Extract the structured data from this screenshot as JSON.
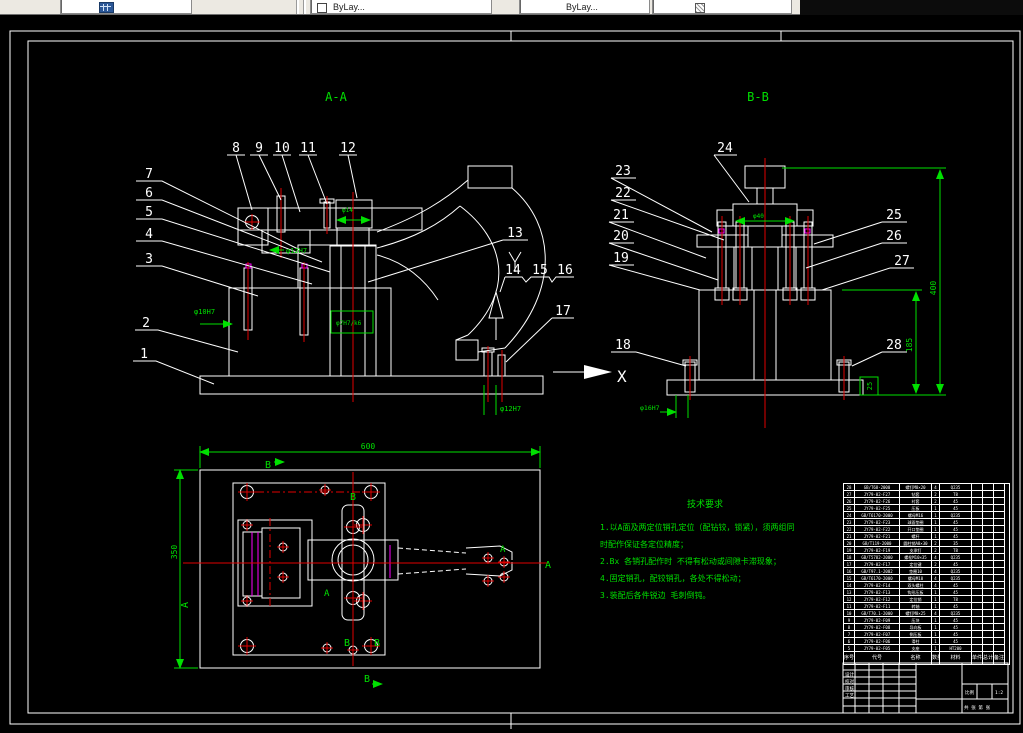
{
  "toolbar": {
    "color_combo": "ByLay...",
    "linetype_combo": "ByLay...",
    "lineweight_combo": ""
  },
  "sheet": {
    "section_a_title": "A-A",
    "section_b_title": "B-B"
  },
  "callouts": {
    "aa_left": [
      "7",
      "6",
      "5",
      "4",
      "3"
    ],
    "aa_lower_left": [
      "2",
      "1"
    ],
    "aa_top": [
      "8",
      "9",
      "10",
      "11",
      "12"
    ],
    "aa_right": [
      "13",
      "14",
      "15",
      "16",
      "17"
    ],
    "bb_top": [
      "24"
    ],
    "bb_left": [
      "23",
      "22",
      "21",
      "20",
      "19"
    ],
    "bb_right": [
      "25",
      "26",
      "27"
    ],
    "bb_bottom_left": [
      "18"
    ],
    "bb_bottom_right": [
      "28"
    ],
    "x_mark": "X"
  },
  "dims": {
    "plan_w": "600",
    "plan_h": "350",
    "total_h": "400",
    "base_h": "185",
    "plate_t": "25",
    "bore_center": "φ7H7/k6",
    "pin_left": "φ10H7",
    "pin_mid": "φ12H7",
    "pin_bottom_a": "φ12H7",
    "pin_bottom_b": "φ16H7",
    "nut_dia": "φ40",
    "arm_dia": "φ14"
  },
  "plan_marks": {
    "b_top": "B",
    "b_in_top": "B",
    "b_in_bot": "B",
    "b_out_bot": "B",
    "bl": "B",
    "a_left": "A",
    "a_right": "A",
    "a_mid": "A",
    "a_in": "A"
  },
  "tech_notes": {
    "title": "技术要求",
    "lines": [
      "1.以A面及两定位销孔定位（配钻铰，锁紧），须两组同",
      "时配作保证各定位精度；",
      "2.Bx 各销孔配作时 不得有松动或间隙卡滞现象；",
      "4.固定销孔，配铰销孔，各处不得松动；",
      "3.装配后各件锐边 毛刺倒钝。"
    ]
  },
  "bom": {
    "headers": [
      "序号",
      "代号",
      "名称",
      "数量",
      "材料",
      "单件",
      "总计",
      "备注"
    ],
    "rows": [
      [
        "28",
        "GB/T68-2000",
        "螺钉M8×20",
        "4",
        "Q235",
        "",
        "",
        ""
      ],
      [
        "27",
        "JY79-02-F27",
        "钻套",
        "2",
        "T8",
        "",
        "",
        ""
      ],
      [
        "26",
        "JY79-02-F26",
        "衬套",
        "2",
        "45",
        "",
        "",
        ""
      ],
      [
        "25",
        "JY79-02-F25",
        "压板",
        "1",
        "45",
        "",
        "",
        ""
      ],
      [
        "24",
        "GB/T6170-2000",
        "螺母M16",
        "1",
        "Q235",
        "",
        "",
        ""
      ],
      [
        "23",
        "JY79-02-F23",
        "球面垫圈",
        "1",
        "45",
        "",
        "",
        ""
      ],
      [
        "22",
        "JY79-02-F22",
        "开口垫圈",
        "1",
        "45",
        "",
        "",
        ""
      ],
      [
        "21",
        "JY79-02-F21",
        "螺杆",
        "1",
        "45",
        "",
        "",
        ""
      ],
      [
        "20",
        "GB/T119-2000",
        "圆柱销A8×30",
        "2",
        "35",
        "",
        "",
        ""
      ],
      [
        "19",
        "JY79-02-F19",
        "支承钉",
        "2",
        "T8",
        "",
        "",
        ""
      ],
      [
        "18",
        "GB/T5782-2000",
        "螺栓M10×35",
        "4",
        "Q235",
        "",
        "",
        ""
      ],
      [
        "17",
        "JY79-02-F17",
        "定位键",
        "2",
        "45",
        "",
        "",
        ""
      ],
      [
        "16",
        "GB/T97.1-2002",
        "垫圈10",
        "4",
        "Q235",
        "",
        "",
        ""
      ],
      [
        "15",
        "GB/T6170-2000",
        "螺母M10",
        "4",
        "Q235",
        "",
        "",
        ""
      ],
      [
        "14",
        "JY79-02-F14",
        "双头螺柱",
        "4",
        "45",
        "",
        "",
        ""
      ],
      [
        "13",
        "JY79-02-F13",
        "钩形压板",
        "1",
        "45",
        "",
        "",
        ""
      ],
      [
        "12",
        "JY79-02-F12",
        "定位销",
        "1",
        "T8",
        "",
        "",
        ""
      ],
      [
        "11",
        "JY79-02-F11",
        "转轴",
        "1",
        "45",
        "",
        "",
        ""
      ],
      [
        "10",
        "GB/T70.1-2000",
        "螺钉M8×25",
        "4",
        "Q235",
        "",
        "",
        ""
      ],
      [
        "9",
        "JY79-02-F09",
        "压块",
        "1",
        "45",
        "",
        "",
        ""
      ],
      [
        "8",
        "JY79-02-F08",
        "导向板",
        "1",
        "45",
        "",
        "",
        ""
      ],
      [
        "7",
        "JY79-02-F07",
        "侧压板",
        "1",
        "45",
        "",
        "",
        ""
      ],
      [
        "6",
        "JY79-02-F06",
        "滑柱",
        "1",
        "45",
        "",
        "",
        ""
      ],
      [
        "5",
        "JY79-02-F05",
        "支座",
        "1",
        "HT200",
        "",
        "",
        ""
      ]
    ]
  },
  "title_block": {
    "r1": "设计",
    "r2": "校对",
    "r3": "审核",
    "r4": "工艺",
    "scale_label": "比例",
    "scale": "1:2",
    "sheet_label": "共 张 第 张"
  }
}
